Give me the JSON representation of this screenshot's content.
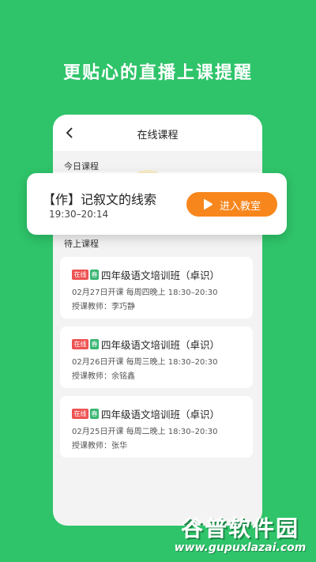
{
  "headline": "更贴心的直播上课提醒",
  "header": {
    "title": "在线课程",
    "back_icon": "chevron-left-icon"
  },
  "sections": {
    "today": "今日课程",
    "upcoming": "待上课程"
  },
  "popup": {
    "title": "【作】记叙文的线索",
    "time": "19:30–20:14",
    "enter_label": "进入教室",
    "enter_icon": "play-icon",
    "button_color": "#f7861c"
  },
  "courses": [
    {
      "tag_status": "在线",
      "tag_season": "春",
      "title": "四年级语文培训班（卓识）",
      "schedule": "02月27日开课  每周四晚上 18:30–20:30",
      "teacher": "授课教师：李巧静"
    },
    {
      "tag_status": "在线",
      "tag_season": "春",
      "title": "四年级语文培训班（卓识）",
      "schedule": "02月26日开课  每周三晚上 18:30–20:30",
      "teacher": "授课教师：余铭鑫"
    },
    {
      "tag_status": "在线",
      "tag_season": "春",
      "title": "四年级语文培训班（卓识）",
      "schedule": "02月25日开课  每周二晚上 18:30–20:30",
      "teacher": "授课教师：张华"
    }
  ],
  "watermark": {
    "name": "谷普软件园",
    "url": "www.gupuxlazai.com"
  },
  "colors": {
    "background": "#2fc46a",
    "tag_online": "#ee5353",
    "tag_season": "#39b672"
  }
}
